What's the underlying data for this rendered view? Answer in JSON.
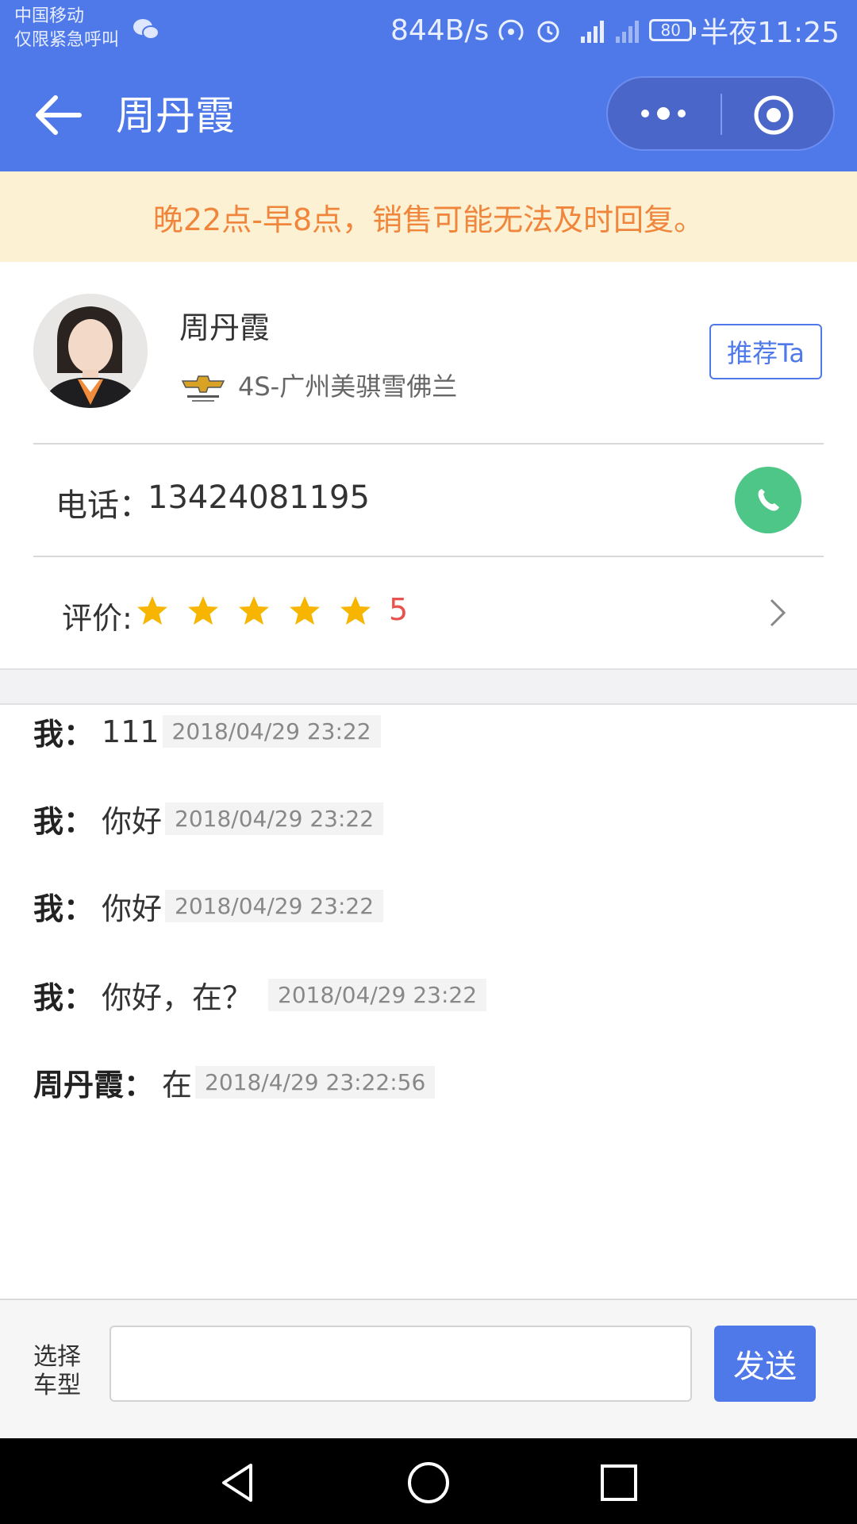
{
  "status_bar": {
    "carrier_line1": "中国移动",
    "carrier_line2": "仅限紧急呼叫",
    "net_speed": "844B/s",
    "battery": "80",
    "time": "半夜11:25"
  },
  "nav": {
    "title": "周丹霞"
  },
  "notice": "晚22点-早8点，销售可能无法及时回复。",
  "profile": {
    "name": "周丹霞",
    "dealer": "4S-广州美骐雪佛兰",
    "recommend_label": "推荐Ta",
    "phone_label": "电话：",
    "phone_number": "13424081195",
    "rating_label": "评价:",
    "rating_value": "5",
    "stars": 5
  },
  "messages": [
    {
      "sender": "我：",
      "text": "111",
      "time": "2018/04/29 23:22"
    },
    {
      "sender": "我：",
      "text": "你好",
      "time": "2018/04/29 23:22"
    },
    {
      "sender": "我：",
      "text": "你好",
      "time": "2018/04/29 23:22"
    },
    {
      "sender": "我：",
      "text": "你好，在？",
      "time": "2018/04/29 23:22"
    },
    {
      "sender": "周丹霞：",
      "text": "在",
      "time": "2018/4/29 23:22:56"
    }
  ],
  "input_bar": {
    "car_select_label": "选择车型",
    "input_value": "",
    "send_label": "发送"
  },
  "colors": {
    "primary": "#4f79e8",
    "notice_bg": "#fdf1d4",
    "notice_text": "#f0863c",
    "call_green": "#4dc688",
    "star": "#f7b500",
    "rating_red": "#e9534d"
  },
  "icons": [
    "back-arrow-icon",
    "more-dots-icon",
    "close-target-icon",
    "chevrolet-logo-icon",
    "phone-icon",
    "star-icon",
    "chevron-right-icon",
    "wechat-icon",
    "hotspot-icon",
    "alarm-icon",
    "signal-icon",
    "battery-icon",
    "android-back-icon",
    "android-home-icon",
    "android-recents-icon"
  ]
}
